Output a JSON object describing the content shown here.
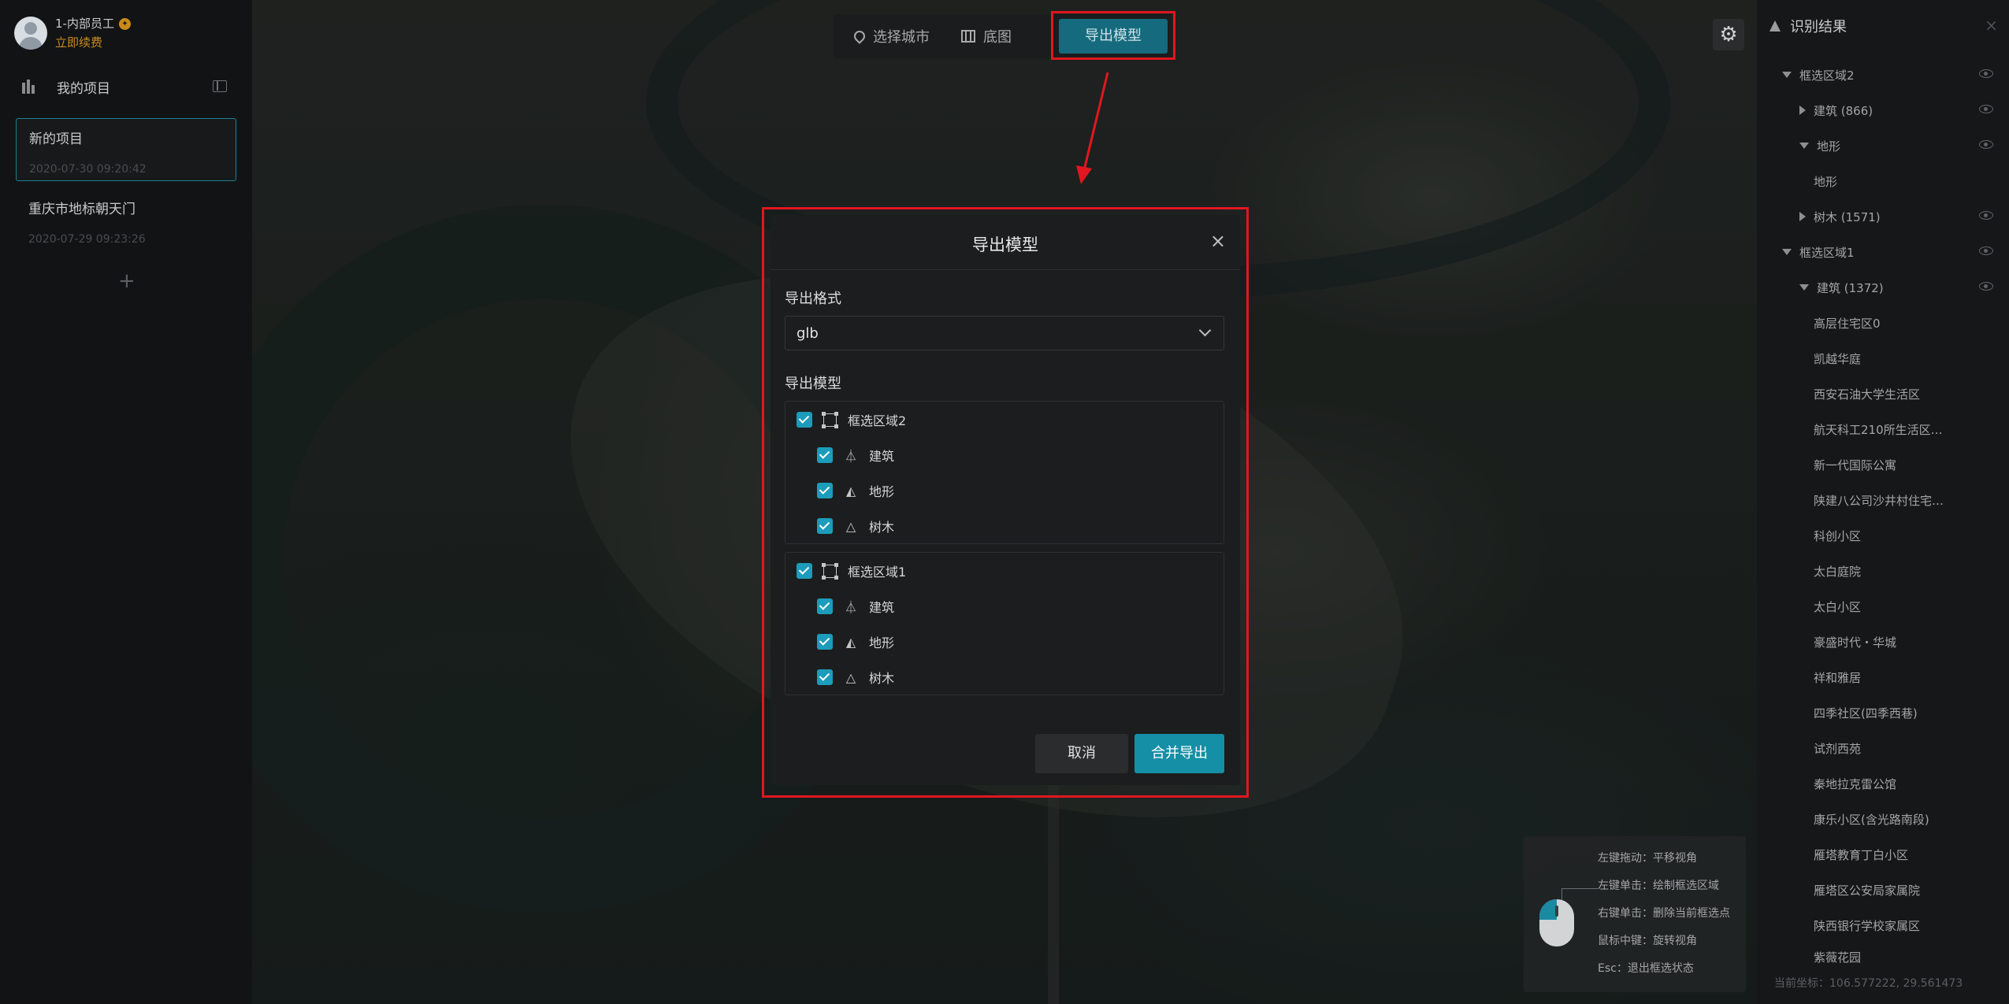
{
  "user": {
    "name": "1-内部员工",
    "renew_label": "立即续费"
  },
  "sidebar": {
    "title": "我的项目",
    "projects": [
      {
        "name": "新的项目",
        "date": "2020-07-30 09:20:42",
        "active": true
      },
      {
        "name": "重庆市地标朝天门",
        "date": "2020-07-29 09:23:26",
        "active": false
      }
    ],
    "add_label": "+"
  },
  "toolbar": {
    "select_city": "选择城市",
    "basemap": "底图",
    "export_model": "导出模型"
  },
  "modal": {
    "title": "导出模型",
    "close": "×",
    "format_label": "导出格式",
    "format_value": "glb",
    "model_label": "导出模型",
    "groups": [
      {
        "name": "框选区域2",
        "children": [
          {
            "name": "建筑",
            "icon": "building-icon"
          },
          {
            "name": "地形",
            "icon": "terrain-icon"
          },
          {
            "name": "树木",
            "icon": "tree-icon"
          }
        ]
      },
      {
        "name": "框选区域1",
        "children": [
          {
            "name": "建筑",
            "icon": "building-icon"
          },
          {
            "name": "地形",
            "icon": "terrain-icon"
          },
          {
            "name": "树木",
            "icon": "tree-icon"
          }
        ]
      }
    ],
    "cancel": "取消",
    "merge_export": "合并导出"
  },
  "hints": [
    "左键拖动：平移视角",
    "左键单击：绘制框选区域",
    "右键单击：删除当前框选点",
    "鼠标中键：旋转视角",
    "Esc：退出框选状态"
  ],
  "results": {
    "title": "识别结果",
    "close": "×",
    "items": [
      {
        "label": "框选区域2",
        "level": 0,
        "caret": "down",
        "eye": true
      },
      {
        "label": "建筑 (866)",
        "level": 1,
        "caret": "right",
        "eye": true
      },
      {
        "label": "地形",
        "level": 1,
        "caret": "down",
        "eye": true
      },
      {
        "label": "地形",
        "level": 2,
        "caret": "",
        "eye": false
      },
      {
        "label": "树木 (1571)",
        "level": 1,
        "caret": "right",
        "eye": true
      },
      {
        "label": "框选区域1",
        "level": 0,
        "caret": "down",
        "eye": true
      },
      {
        "label": "建筑 (1372)",
        "level": 1,
        "caret": "down",
        "eye": true
      },
      {
        "label": "高层住宅区0",
        "level": 2,
        "caret": "",
        "eye": false
      },
      {
        "label": "凯越华庭",
        "level": 2,
        "caret": "",
        "eye": false
      },
      {
        "label": "西安石油大学生活区",
        "level": 2,
        "caret": "",
        "eye": false
      },
      {
        "label": "航天科工210所生活区…",
        "level": 2,
        "caret": "",
        "eye": false
      },
      {
        "label": "新一代国际公寓",
        "level": 2,
        "caret": "",
        "eye": false
      },
      {
        "label": "陕建八公司沙井村住宅…",
        "level": 2,
        "caret": "",
        "eye": false
      },
      {
        "label": "科创小区",
        "level": 2,
        "caret": "",
        "eye": false
      },
      {
        "label": "太白庭院",
        "level": 2,
        "caret": "",
        "eye": false
      },
      {
        "label": "太白小区",
        "level": 2,
        "caret": "",
        "eye": false
      },
      {
        "label": "豪盛时代・华城",
        "level": 2,
        "caret": "",
        "eye": false
      },
      {
        "label": "祥和雅居",
        "level": 2,
        "caret": "",
        "eye": false
      },
      {
        "label": "四季社区(四季西巷)",
        "level": 2,
        "caret": "",
        "eye": false
      },
      {
        "label": "试剂西苑",
        "level": 2,
        "caret": "",
        "eye": false
      },
      {
        "label": "秦地拉克雷公馆",
        "level": 2,
        "caret": "",
        "eye": false
      },
      {
        "label": "康乐小区(含光路南段)",
        "level": 2,
        "caret": "",
        "eye": false
      },
      {
        "label": "雁塔教育丁白小区",
        "level": 2,
        "caret": "",
        "eye": false
      },
      {
        "label": "雁塔区公安局家属院",
        "level": 2,
        "caret": "",
        "eye": false
      },
      {
        "label": "陕西银行学校家属区",
        "level": 2,
        "caret": "",
        "eye": false
      },
      {
        "label": "紫薇花园",
        "level": 2,
        "caret": "",
        "eye": false
      }
    ],
    "coords": "当前坐标：106.577222, 29.561473"
  },
  "colors": {
    "accent": "#158fa6",
    "highlight": "#e0171f",
    "renew": "#c88b22"
  }
}
